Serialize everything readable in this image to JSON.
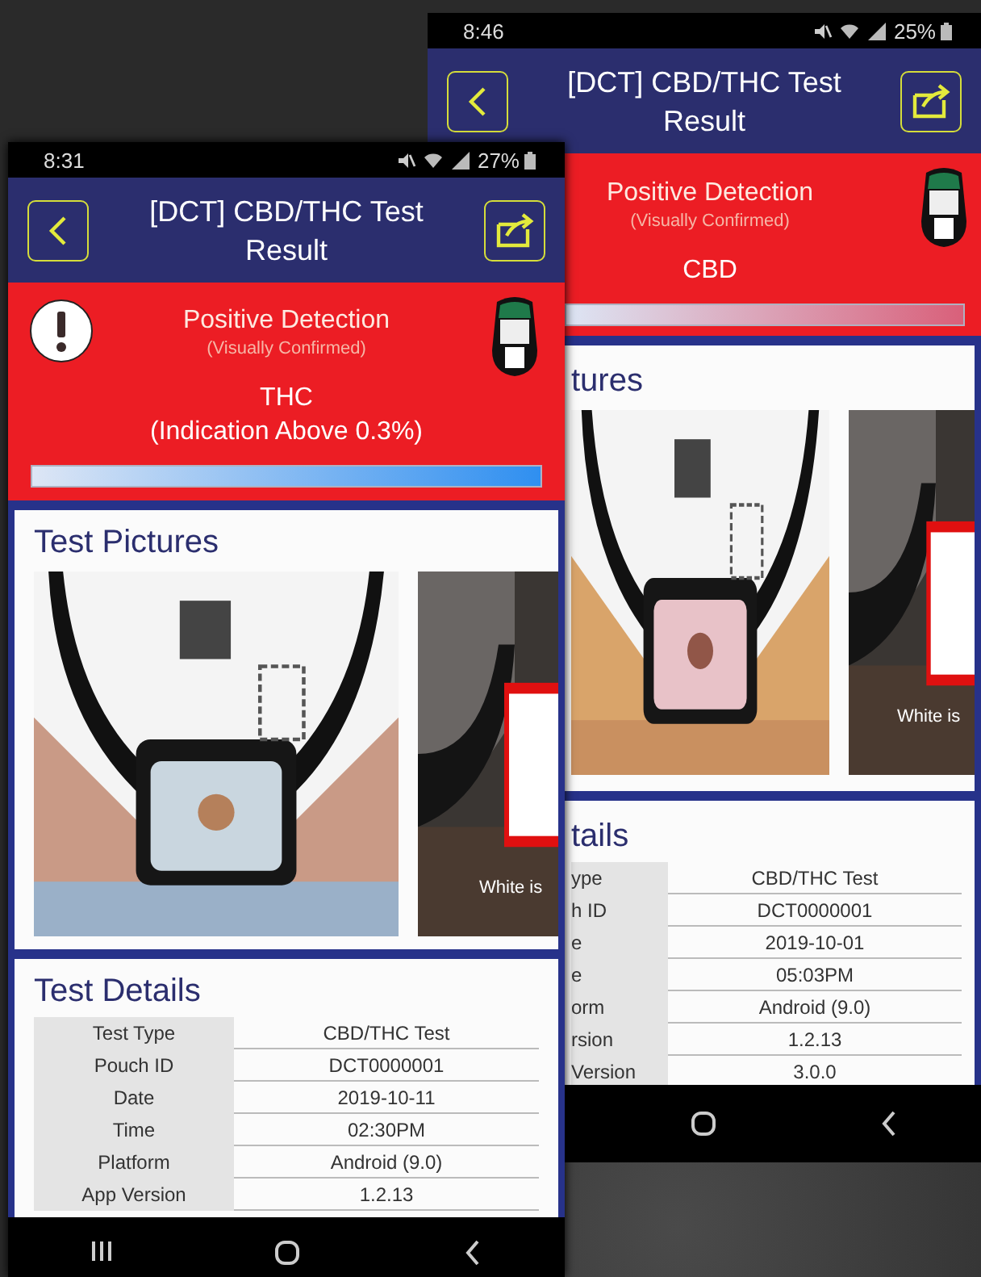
{
  "phones": [
    {
      "status_bar": {
        "time": "8:46",
        "battery": "25%"
      },
      "header": {
        "title": "[DCT] CBD/THC Test Result"
      },
      "result": {
        "title": "Positive Detection",
        "subtitle": "(Visually Confirmed)",
        "substance": "CBD",
        "level": 1,
        "color": "#d9607a"
      },
      "pictures": {
        "heading": "tures",
        "items": [
          {
            "kind": "picture"
          },
          {
            "kind": "picture",
            "caption": "White is"
          }
        ]
      },
      "details": {
        "heading": "tails",
        "rows": [
          {
            "label": "ype",
            "value": "CBD/THC Test"
          },
          {
            "label": "h ID",
            "value": "DCT0000001"
          },
          {
            "label": "e",
            "value": "2019-10-01"
          },
          {
            "label": "e",
            "value": "05:03PM"
          },
          {
            "label": "orm",
            "value": "Android (9.0)"
          },
          {
            "label": "rsion",
            "value": "1.2.13"
          },
          {
            "label": "Version",
            "value": "3.0.0"
          }
        ]
      },
      "nav_buttons": [
        {
          "kind": "home"
        },
        {
          "kind": "back"
        }
      ]
    },
    {
      "status_bar": {
        "time": "8:31",
        "battery": "27%"
      },
      "header": {
        "title": "[DCT] CBD/THC Test Result"
      },
      "result": {
        "alert": true,
        "title": "Positive Detection",
        "subtitle": "(Visually Confirmed)",
        "substance": "THC",
        "note": "(Indication Above 0.3%)",
        "level": 1,
        "color": "#2f8ff0"
      },
      "pictures": {
        "heading": "Test Pictures",
        "items": [
          {
            "kind": "picture"
          },
          {
            "kind": "picture",
            "caption": "White is"
          }
        ]
      },
      "details": {
        "heading": "Test Details",
        "rows": [
          {
            "label": "Test Type",
            "value": "CBD/THC Test"
          },
          {
            "label": "Pouch ID",
            "value": "DCT0000001"
          },
          {
            "label": "Date",
            "value": "2019-10-11"
          },
          {
            "label": "Time",
            "value": "02:30PM"
          },
          {
            "label": "Platform",
            "value": "Android (9.0)"
          },
          {
            "label": "App Version",
            "value": "1.2.13"
          }
        ]
      },
      "nav_buttons": [
        {
          "kind": "recents"
        },
        {
          "kind": "home"
        },
        {
          "kind": "back"
        }
      ]
    }
  ]
}
